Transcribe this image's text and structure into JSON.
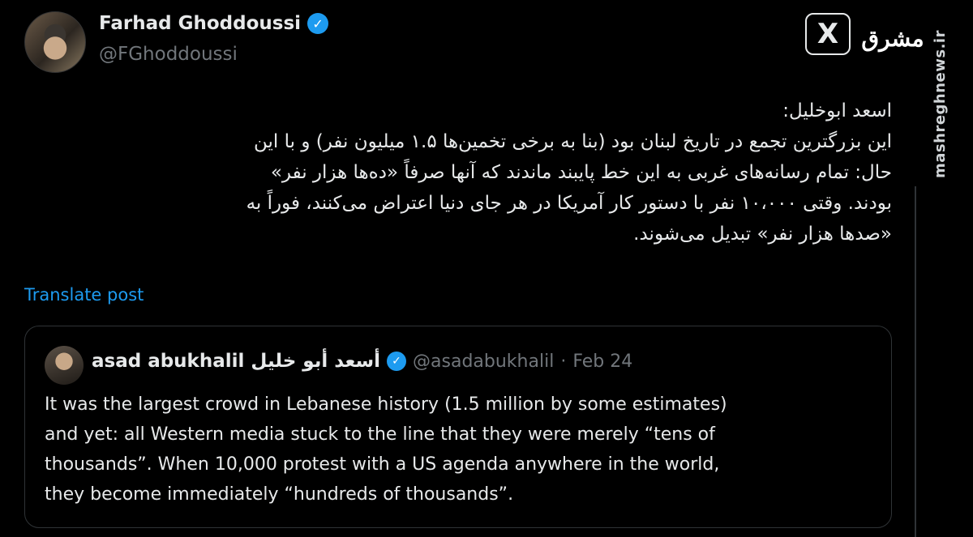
{
  "author": {
    "display_name": "Farhad Ghoddoussi",
    "handle": "@FGhoddoussi"
  },
  "watermark": {
    "x_logo": "X",
    "site_logo": "مشرق",
    "site_url": "mashreghnews.ir"
  },
  "post": {
    "lines": [
      "اسعد ابوخلیل:",
      "این بزرگترین تجمع در تاریخ لبنان بود (بنا به برخی تخمین‌ها ۱.۵ میلیون نفر) و با این",
      "حال: تمام رسانه‌های غربی به این خط پایبند ماندند که آنها صرفاً «ده‌ها هزار نفر»",
      "بودند. وقتی ۱۰،۰۰۰ نفر با دستور کار آمریکا در هر جای دنیا اعتراض می‌کنند، فوراً به",
      "«صدها هزار نفر» تبدیل می‌شوند."
    ]
  },
  "translate_label": "Translate post",
  "quoted": {
    "name": "asad abukhalil أسعد أبو خليل",
    "handle": "@asadabukhalil",
    "separator": "·",
    "date": "Feb 24",
    "lines": [
      "It was the largest crowd in Lebanese history (1.5 million by some estimates)",
      "and yet: all Western media stuck to the line that they were merely “tens of",
      "thousands”.  When 10,000 protest with a US agenda anywhere in the world,",
      "they become immediately “hundreds of thousands”."
    ]
  },
  "icons": {
    "verified": "verified-check-icon"
  },
  "colors": {
    "background": "#000000",
    "text": "#e7e9ea",
    "muted": "#71767b",
    "accent": "#1d9bf0",
    "border": "#2f3336"
  }
}
